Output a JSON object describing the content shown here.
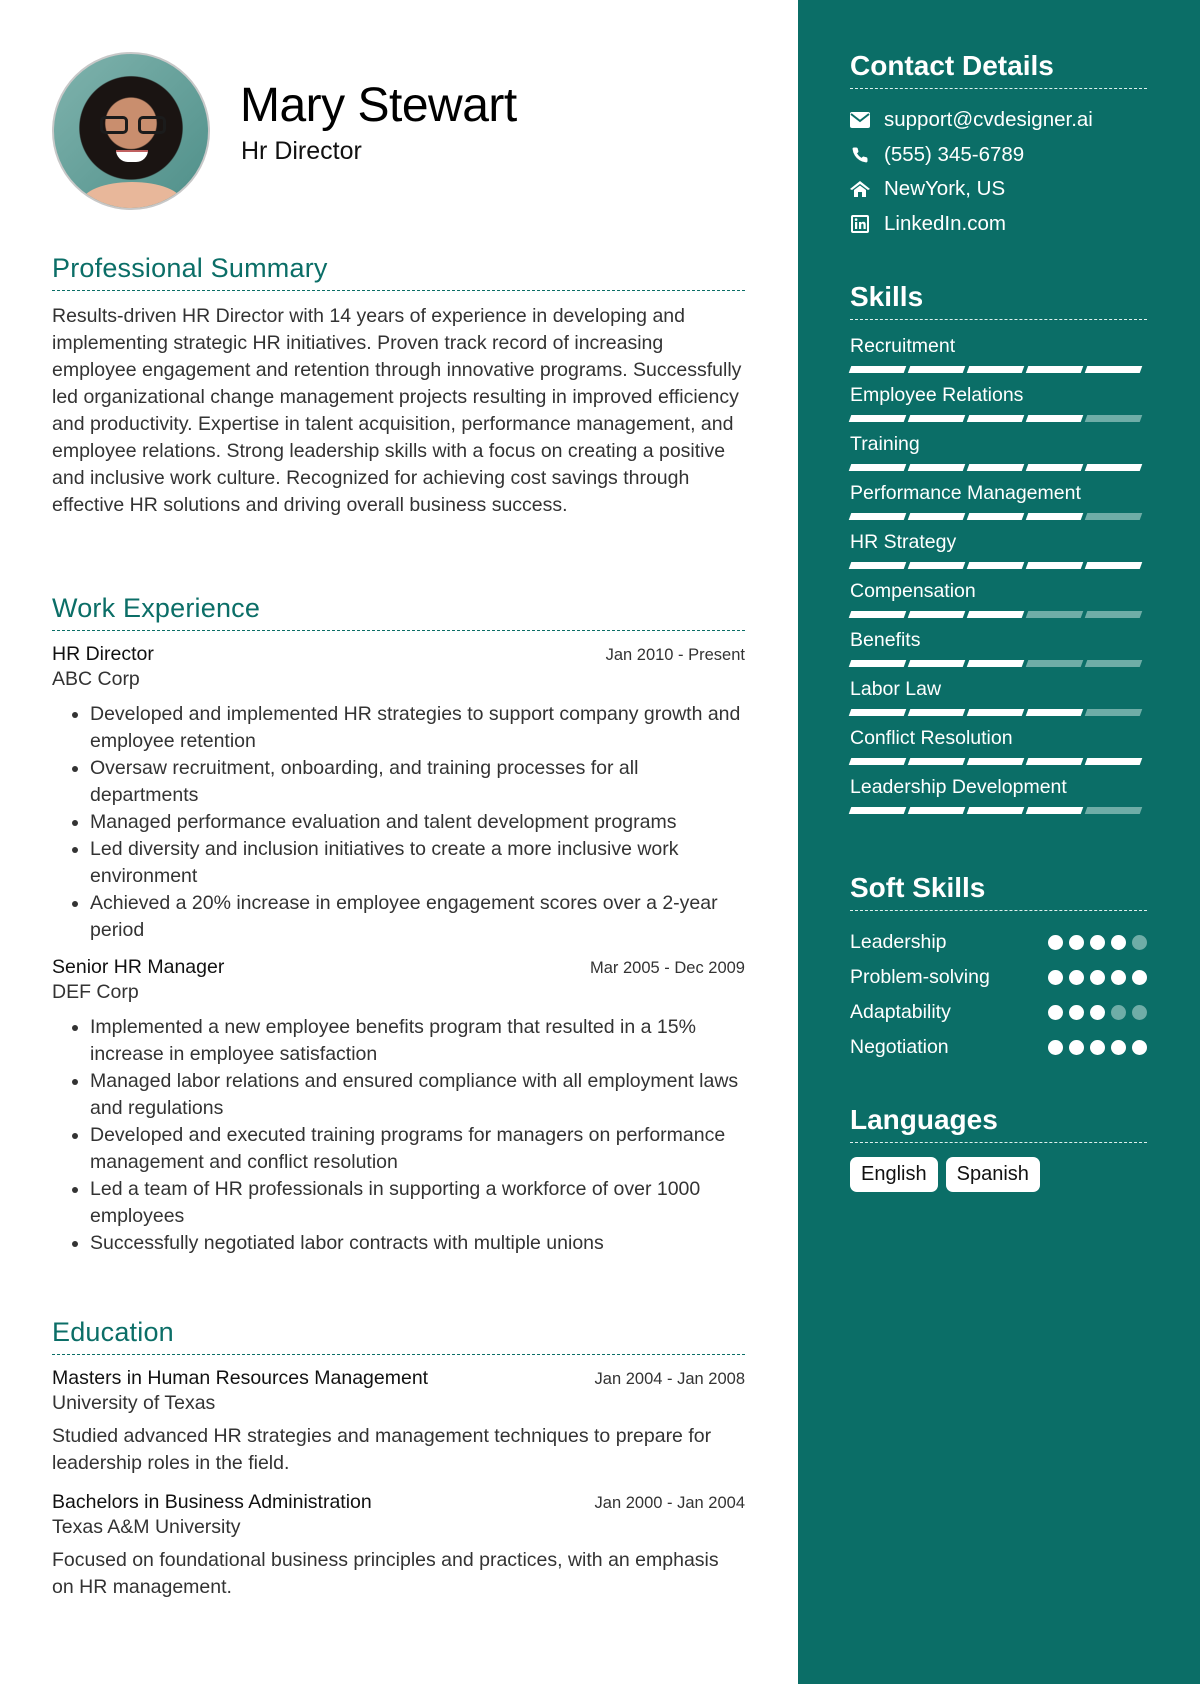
{
  "header": {
    "name": "Mary Stewart",
    "title": "Hr Director"
  },
  "summary": {
    "heading": "Professional Summary",
    "text": "Results-driven HR Director with 14 years of experience in developing and implementing strategic HR initiatives. Proven track record of increasing employee engagement and retention through innovative programs. Successfully led organizational change management projects resulting in improved efficiency and productivity. Expertise in talent acquisition, performance management, and employee relations. Strong leadership skills with a focus on creating a positive and inclusive work culture. Recognized for achieving cost savings through effective HR solutions and driving overall business success."
  },
  "experience": {
    "heading": "Work Experience",
    "jobs": [
      {
        "title": "HR Director",
        "date": "Jan 2010 - Present",
        "company": "ABC Corp",
        "bullets": [
          "Developed and implemented HR strategies to support company growth and employee retention",
          "Oversaw recruitment, onboarding, and training processes for all departments",
          "Managed performance evaluation and talent development programs",
          "Led diversity and inclusion initiatives to create a more inclusive work environment",
          "Achieved a 20% increase in employee engagement scores over a 2-year period"
        ]
      },
      {
        "title": "Senior HR Manager",
        "date": "Mar 2005 - Dec 2009",
        "company": "DEF Corp",
        "bullets": [
          "Implemented a new employee benefits program that resulted in a 15% increase in employee satisfaction",
          "Managed labor relations and ensured compliance with all employment laws and regulations",
          "Developed and executed training programs for managers on performance management and conflict resolution",
          "Led a team of HR professionals in supporting a workforce of over 1000 employees",
          "Successfully negotiated labor contracts with multiple unions"
        ]
      }
    ]
  },
  "education": {
    "heading": "Education",
    "items": [
      {
        "degree": "Masters in Human Resources Management",
        "date": "Jan 2004 - Jan 2008",
        "school": "University of Texas",
        "desc": "Studied advanced HR strategies and management techniques to prepare for leadership roles in the field."
      },
      {
        "degree": "Bachelors in Business Administration",
        "date": "Jan 2000 - Jan 2004",
        "school": "Texas A&M University",
        "desc": "Focused on foundational business principles and practices, with an emphasis on HR management."
      }
    ]
  },
  "contact": {
    "heading": "Contact Details",
    "items": [
      {
        "icon": "envelope-icon",
        "text": "support@cvdesigner.ai"
      },
      {
        "icon": "phone-icon",
        "text": "(555) 345-6789"
      },
      {
        "icon": "home-icon",
        "text": "NewYork, US"
      },
      {
        "icon": "linkedin-icon",
        "text": "LinkedIn.com"
      }
    ]
  },
  "skills": {
    "heading": "Skills",
    "max": 5,
    "items": [
      {
        "name": "Recruitment",
        "level": 5
      },
      {
        "name": "Employee Relations",
        "level": 4
      },
      {
        "name": "Training",
        "level": 5
      },
      {
        "name": "Performance Management",
        "level": 4
      },
      {
        "name": "HR Strategy",
        "level": 5
      },
      {
        "name": "Compensation",
        "level": 3
      },
      {
        "name": "Benefits",
        "level": 3
      },
      {
        "name": "Labor Law",
        "level": 4
      },
      {
        "name": "Conflict Resolution",
        "level": 5
      },
      {
        "name": "Leadership Development",
        "level": 4
      }
    ]
  },
  "soft_skills": {
    "heading": "Soft Skills",
    "max": 5,
    "items": [
      {
        "name": "Leadership",
        "level": 4
      },
      {
        "name": "Problem-solving",
        "level": 5
      },
      {
        "name": "Adaptability",
        "level": 3
      },
      {
        "name": "Negotiation",
        "level": 5
      }
    ]
  },
  "languages": {
    "heading": "Languages",
    "items": [
      "English",
      "Spanish"
    ]
  },
  "colors": {
    "accent": "#0b6e67",
    "inactive": "#6fada7"
  }
}
